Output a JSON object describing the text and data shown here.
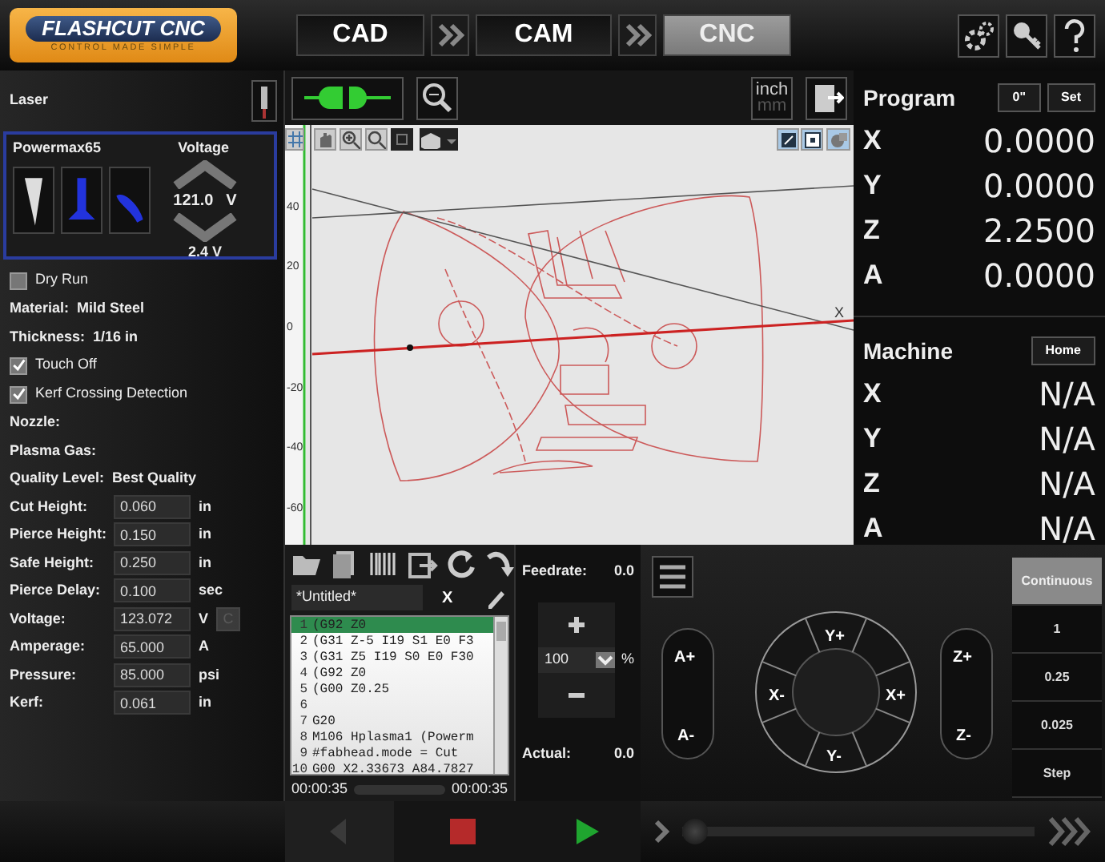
{
  "header": {
    "logo_title": "FLASHCUT CNC",
    "logo_tagline": "CONTROL MADE SIMPLE",
    "tabs": [
      {
        "label": "CAD",
        "selected": false
      },
      {
        "label": "CAM",
        "selected": false
      },
      {
        "label": "CNC",
        "selected": true
      }
    ]
  },
  "tool": {
    "label": "Laser"
  },
  "plasma": {
    "title": "Powermax65",
    "voltage_label": "Voltage",
    "voltage": "121.0",
    "voltage_unit": "V",
    "step": "2.4 V"
  },
  "settings": [
    {
      "kind": "checkbox",
      "label": "Dry Run",
      "checked": false
    },
    {
      "kind": "info",
      "label": "Material:",
      "value": "Mild Steel"
    },
    {
      "kind": "info",
      "label": "Thickness:",
      "value": "1/16 in"
    },
    {
      "kind": "checkbox",
      "label": "Touch Off",
      "checked": true
    },
    {
      "kind": "checkbox",
      "label": "Kerf Crossing Detection",
      "checked": true
    },
    {
      "kind": "info",
      "label": "Nozzle:"
    },
    {
      "kind": "info",
      "label": "Plasma Gas:"
    },
    {
      "kind": "info",
      "label": "Quality Level:",
      "value": "Best Quality"
    },
    {
      "kind": "field",
      "label": "Cut Height:",
      "value": "0.060",
      "unit": "in"
    },
    {
      "kind": "field",
      "label": "Pierce Height:",
      "value": "0.150",
      "unit": "in"
    },
    {
      "kind": "field",
      "label": "Safe Height:",
      "value": "0.250",
      "unit": "in"
    },
    {
      "kind": "field",
      "label": "Pierce Delay:",
      "value": "0.100",
      "unit": "sec"
    },
    {
      "kind": "field",
      "label": "Voltage:",
      "value": "123.072",
      "unit": "V",
      "reset_button": {
        "label": "C",
        "disabled": true
      }
    },
    {
      "kind": "field",
      "label": "Amperage:",
      "value": "65.000",
      "unit": "A"
    },
    {
      "kind": "field",
      "label": "Pressure:",
      "value": "85.000",
      "unit": "psi"
    },
    {
      "kind": "field",
      "label": "Kerf:",
      "value": "0.061",
      "unit": "in"
    }
  ],
  "units": [
    {
      "label": "inch",
      "selected": true
    },
    {
      "label": "mm",
      "selected": false
    }
  ],
  "canvas": {
    "y_ticks": [
      "40",
      "20",
      "0",
      "-20",
      "-40",
      "-60"
    ],
    "x_axis_label": "X"
  },
  "program": {
    "title": "Program",
    "zero_button": "0\"",
    "set_button": "Set",
    "axes": [
      {
        "axis": "X",
        "value": "0.0000"
      },
      {
        "axis": "Y",
        "value": "0.0000"
      },
      {
        "axis": "Z",
        "value": "2.2500"
      },
      {
        "axis": "A",
        "value": "0.0000"
      }
    ]
  },
  "machine": {
    "title": "Machine",
    "home_button": "Home",
    "axes": [
      {
        "axis": "X",
        "value": "N/A"
      },
      {
        "axis": "Y",
        "value": "N/A"
      },
      {
        "axis": "Z",
        "value": "N/A"
      },
      {
        "axis": "A",
        "value": "N/A"
      }
    ]
  },
  "editor": {
    "file_name": "*Untitled*",
    "close": "X",
    "lines": [
      {
        "number": "1",
        "code": "(G92 Z0",
        "selected": true
      },
      {
        "number": "2",
        "code": "(G31 Z-5 I19 S1 E0 F3",
        "selected": false
      },
      {
        "number": "3",
        "code": "(G31 Z5 I19 S0 E0 F30",
        "selected": false
      },
      {
        "number": "4",
        "code": "(G92 Z0",
        "selected": false
      },
      {
        "number": "5",
        "code": "(G00 Z0.25",
        "selected": false
      },
      {
        "number": "6",
        "selected": false
      },
      {
        "number": "7",
        "code": "G20",
        "selected": false
      },
      {
        "number": "8",
        "code": "M106 Hplasma1 (Powerm",
        "selected": false
      },
      {
        "number": "9",
        "code": "#fabhead.mode = Cut",
        "selected": false
      },
      {
        "number": "10",
        "code": "G00 X2.33673 A84.7827",
        "selected": false
      }
    ],
    "time_elapsed": "00:00:35",
    "time_total": "00:00:35"
  },
  "feed": {
    "label": "Feedrate:",
    "value": "0.0",
    "override": "100",
    "percent": "%",
    "actual_label": "Actual:",
    "actual": "0.0"
  },
  "jog": {
    "a_plus": "A+",
    "a_minus": "A-",
    "y_plus": "Y+",
    "x_minus": "X-",
    "x_plus": "X+",
    "y_minus": "Y-",
    "z_plus": "Z+",
    "z_minus": "Z-",
    "steps": [
      {
        "label": "Continuous",
        "selected": true
      },
      {
        "label": "1",
        "selected": false
      },
      {
        "label": "0.25",
        "selected": false
      },
      {
        "label": "0.025",
        "selected": false
      },
      {
        "label": "Step",
        "selected": false
      }
    ]
  },
  "transport": [
    {
      "kind": "back",
      "disabled": true
    },
    {
      "kind": "stop",
      "disabled": false
    },
    {
      "kind": "play",
      "disabled": false
    }
  ],
  "speed": {
    "level": 0
  }
}
